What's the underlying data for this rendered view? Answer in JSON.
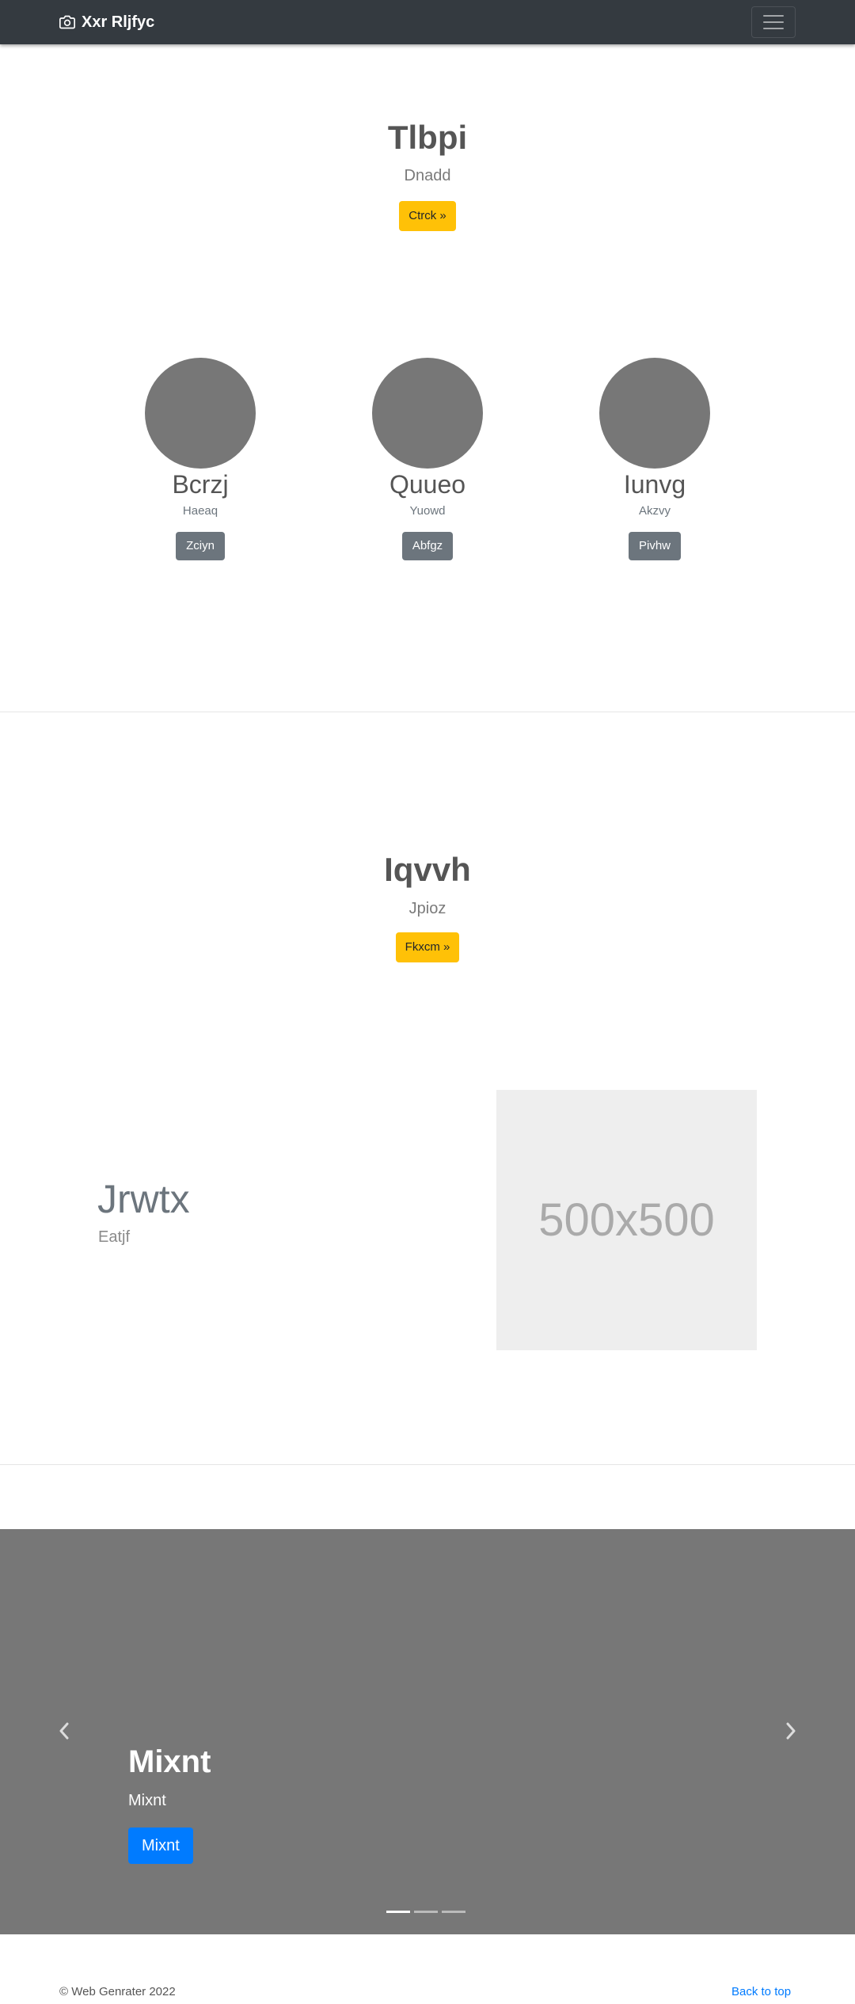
{
  "navbar": {
    "brand": "Xxr Rljfyc",
    "brand_icon": "camera-icon",
    "menu_icon": "hamburger-icon"
  },
  "hero1": {
    "title": "Tlbpi",
    "lead": "Dnadd",
    "button": "Ctrck »"
  },
  "features": [
    {
      "title": "Bcrzj",
      "text": "Haeaq",
      "button": "Zciyn"
    },
    {
      "title": "Quueo",
      "text": "Yuowd",
      "button": "Abfgz"
    },
    {
      "title": "Iunvg",
      "text": "Akzvy",
      "button": "Pivhw"
    }
  ],
  "hero2": {
    "title": "Iqvvh",
    "lead": "Jpioz",
    "button": "Fkxcm »"
  },
  "featurette": {
    "heading": "Jrwtx",
    "lead": "Eatjf",
    "image_label": "500x500"
  },
  "carousel": {
    "title": "Mixnt",
    "text": "Mixnt",
    "button": "Mixnt",
    "prev_icon": "chevron-left-icon",
    "next_icon": "chevron-right-icon",
    "slide_count": 3,
    "active_slide": 1
  },
  "footer": {
    "copyright": "© Web Genrater 2022",
    "back_to_top": "Back to top"
  },
  "colors": {
    "navbar": "#343a40",
    "warning": "#ffc107",
    "secondary": "#6c757d",
    "primary": "#007bff",
    "carousel_bg": "#777777"
  }
}
